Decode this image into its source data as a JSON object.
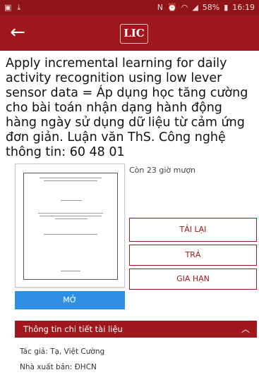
{
  "status_bar": {
    "left_icons": [
      "gallery-icon",
      "download-icon"
    ],
    "battery": "58%",
    "time": "16:19",
    "right_icons": [
      "nfc-icon",
      "alarm-icon",
      "wifi-icon",
      "signal-icon",
      "battery-icon"
    ]
  },
  "app_bar": {
    "back_icon": "arrow-left-icon",
    "logo": "LIC"
  },
  "document": {
    "title": "Apply incremental learning for daily activity recognition using low lever sensor data = Áp dụng học tăng cường cho bài toán nhận dạng hành động hàng ngày sử dụng dữ liệu từ cảm ứng đơn giản. Luận văn ThS. Công nghệ thông tin: 60 48 01",
    "remaining": "Còn 23 giờ mượn"
  },
  "actions": {
    "reload": "TẢI LẠI",
    "return": "TRẢ",
    "renew": "GIA HẠN",
    "open": "MỞ"
  },
  "details": {
    "header": "Thông tin chi tiết tài liệu",
    "author": "Tác giả: Tạ, Việt Cường",
    "publisher": "Nhà xuất bản: ĐHCN"
  },
  "colors": {
    "primary": "#a0181d",
    "status_bar": "#8d1519",
    "open_button": "#2e8fe4"
  }
}
